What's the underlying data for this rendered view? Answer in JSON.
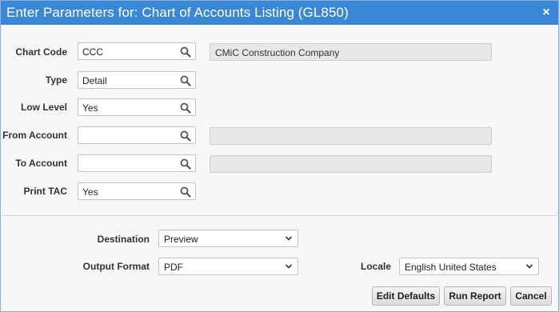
{
  "dialog": {
    "title": "Enter Parameters for: Chart of Accounts Listing (GL850)",
    "close_glyph": "×"
  },
  "params": {
    "chart_code": {
      "label": "Chart Code",
      "value": "CCC",
      "description": "CMiC Construction Company"
    },
    "type": {
      "label": "Type",
      "value": "Detail"
    },
    "low_level": {
      "label": "Low Level",
      "value": "Yes"
    },
    "from_account": {
      "label": "From Account",
      "value": "",
      "description": ""
    },
    "to_account": {
      "label": "To Account",
      "value": "",
      "description": ""
    },
    "print_tac": {
      "label": "Print TAC",
      "value": "Yes"
    }
  },
  "output": {
    "destination": {
      "label": "Destination",
      "value": "Preview"
    },
    "output_format": {
      "label": "Output Format",
      "value": "PDF"
    },
    "locale": {
      "label": "Locale",
      "value": "English United States"
    }
  },
  "buttons": {
    "edit_defaults": "Edit Defaults",
    "run_report": "Run Report",
    "cancel": "Cancel"
  },
  "icons": {
    "lookup": "search-icon",
    "dropdown": "chevron-down-icon",
    "close": "close-icon"
  },
  "colors": {
    "titlebar": "#3a87d6",
    "readonly_field": "#e8e8e8"
  }
}
